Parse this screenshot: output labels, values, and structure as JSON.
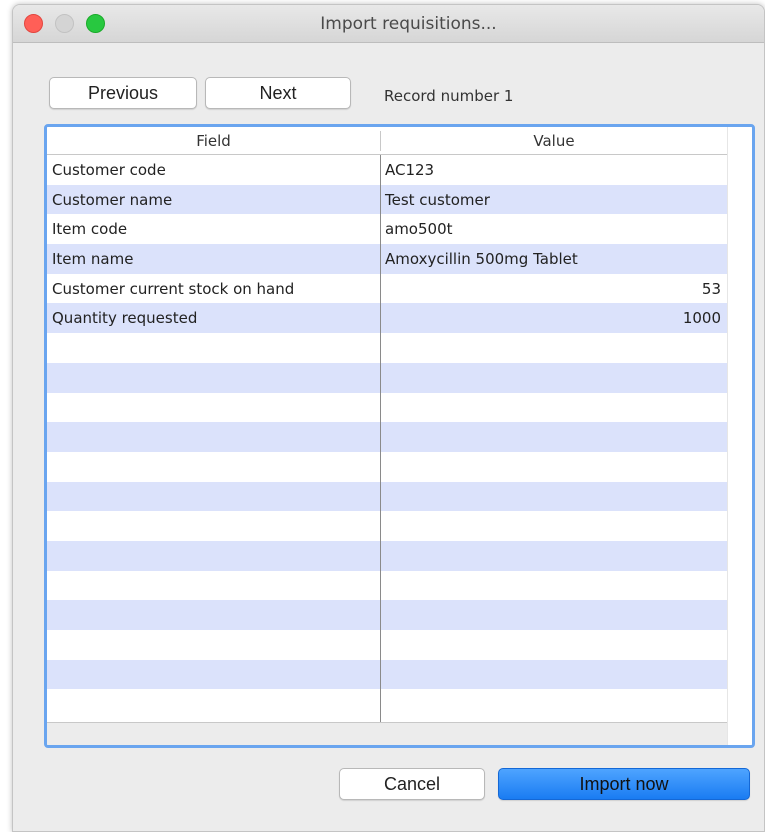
{
  "window": {
    "title": "Import requisitions..."
  },
  "nav": {
    "previous_label": "Previous",
    "next_label": "Next",
    "record_label": "Record number 1"
  },
  "table": {
    "columns": [
      "Field",
      "Value"
    ],
    "rows": [
      {
        "field": "Customer code",
        "value": "AC123",
        "numeric": false
      },
      {
        "field": "Customer name",
        "value": "Test customer",
        "numeric": false
      },
      {
        "field": "Item code",
        "value": "amo500t",
        "numeric": false
      },
      {
        "field": "Item name",
        "value": "Amoxycillin 500mg Tablet",
        "numeric": false
      },
      {
        "field": "Customer current stock on hand",
        "value": "53",
        "numeric": true
      },
      {
        "field": "Quantity requested",
        "value": "1000",
        "numeric": true
      }
    ],
    "empty_rows": 13
  },
  "footer": {
    "cancel_label": "Cancel",
    "import_label": "Import now"
  },
  "colors": {
    "accent": "#1a7cf2",
    "row_alt": "#dbe2fb",
    "focus_border": "#6aa5ef"
  }
}
